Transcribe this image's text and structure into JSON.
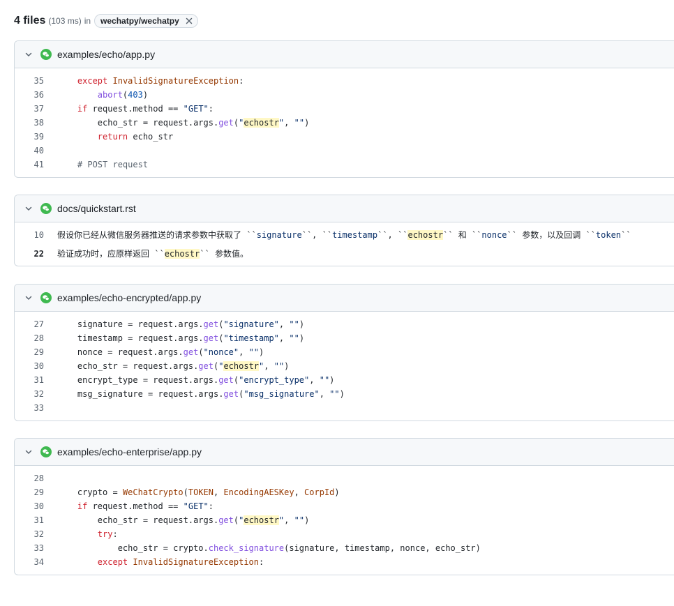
{
  "search": {
    "file_count": "4 files",
    "timing": "(103 ms)",
    "in_label": "in",
    "repo": "wechatpy/wechatpy"
  },
  "results": [
    {
      "path": "examples/echo/app.py",
      "lines": [
        {
          "n": "35",
          "tokens": [
            [
              "",
              "    "
            ],
            [
              "k",
              "except"
            ],
            [
              "",
              " "
            ],
            [
              "cn",
              "InvalidSignatureException"
            ],
            [
              "",
              ":"
            ]
          ]
        },
        {
          "n": "36",
          "tokens": [
            [
              "",
              "        "
            ],
            [
              "f",
              "abort"
            ],
            [
              "",
              "("
            ],
            [
              "n",
              "403"
            ],
            [
              "",
              ")"
            ]
          ]
        },
        {
          "n": "37",
          "tokens": [
            [
              "",
              "    "
            ],
            [
              "k",
              "if"
            ],
            [
              "",
              " request.method == "
            ],
            [
              "s",
              "\"GET\""
            ],
            [
              "",
              ":"
            ]
          ]
        },
        {
          "n": "38",
          "tokens": [
            [
              "",
              "        echo_str = request.args."
            ],
            [
              "f",
              "get"
            ],
            [
              "",
              "("
            ],
            [
              "s",
              "\""
            ],
            [
              "hl",
              "echostr"
            ],
            [
              "s",
              "\""
            ],
            [
              "",
              ", "
            ],
            [
              "s",
              "\"\""
            ],
            [
              "",
              ")"
            ]
          ]
        },
        {
          "n": "39",
          "tokens": [
            [
              "",
              "        "
            ],
            [
              "k",
              "return"
            ],
            [
              "",
              " echo_str"
            ]
          ]
        },
        {
          "n": "40",
          "tokens": []
        },
        {
          "n": "41",
          "tokens": [
            [
              "",
              "    "
            ],
            [
              "c",
              "# POST request"
            ]
          ]
        }
      ]
    },
    {
      "path": "docs/quickstart.rst",
      "lines": [
        {
          "n": "10",
          "hit": false,
          "tokens": [
            [
              "",
              "假设你已经从微信服务器推送的请求参数中获取了 ``"
            ],
            [
              "s",
              "signature"
            ],
            [
              "",
              "``, ``"
            ],
            [
              "s",
              "timestamp"
            ],
            [
              "",
              "``, ``"
            ],
            [
              "hl",
              "echostr"
            ],
            [
              "",
              "`` 和 ``"
            ],
            [
              "s",
              "nonce"
            ],
            [
              "",
              "`` 参数，以及回调 ``"
            ],
            [
              "s",
              "token"
            ],
            [
              "",
              "``"
            ]
          ]
        },
        {
          "n": "22",
          "hit": true,
          "tokens": [
            [
              "",
              "验证成功时，应原样返回 ``"
            ],
            [
              "hl",
              "echostr"
            ],
            [
              "",
              "`` 参数值。"
            ]
          ]
        }
      ]
    },
    {
      "path": "examples/echo-encrypted/app.py",
      "lines": [
        {
          "n": "27",
          "tokens": [
            [
              "",
              "    signature = request.args."
            ],
            [
              "f",
              "get"
            ],
            [
              "",
              "("
            ],
            [
              "s",
              "\"signature\""
            ],
            [
              "",
              ", "
            ],
            [
              "s",
              "\"\""
            ],
            [
              "",
              ")"
            ]
          ]
        },
        {
          "n": "28",
          "tokens": [
            [
              "",
              "    timestamp = request.args."
            ],
            [
              "f",
              "get"
            ],
            [
              "",
              "("
            ],
            [
              "s",
              "\"timestamp\""
            ],
            [
              "",
              ", "
            ],
            [
              "s",
              "\"\""
            ],
            [
              "",
              ")"
            ]
          ]
        },
        {
          "n": "29",
          "tokens": [
            [
              "",
              "    nonce = request.args."
            ],
            [
              "f",
              "get"
            ],
            [
              "",
              "("
            ],
            [
              "s",
              "\"nonce\""
            ],
            [
              "",
              ", "
            ],
            [
              "s",
              "\"\""
            ],
            [
              "",
              ")"
            ]
          ]
        },
        {
          "n": "30",
          "tokens": [
            [
              "",
              "    echo_str = request.args."
            ],
            [
              "f",
              "get"
            ],
            [
              "",
              "("
            ],
            [
              "s",
              "\""
            ],
            [
              "hl",
              "echostr"
            ],
            [
              "s",
              "\""
            ],
            [
              "",
              ", "
            ],
            [
              "s",
              "\"\""
            ],
            [
              "",
              ")"
            ]
          ]
        },
        {
          "n": "31",
          "tokens": [
            [
              "",
              "    encrypt_type = request.args."
            ],
            [
              "f",
              "get"
            ],
            [
              "",
              "("
            ],
            [
              "s",
              "\"encrypt_type\""
            ],
            [
              "",
              ", "
            ],
            [
              "s",
              "\"\""
            ],
            [
              "",
              ")"
            ]
          ]
        },
        {
          "n": "32",
          "tokens": [
            [
              "",
              "    msg_signature = request.args."
            ],
            [
              "f",
              "get"
            ],
            [
              "",
              "("
            ],
            [
              "s",
              "\"msg_signature\""
            ],
            [
              "",
              ", "
            ],
            [
              "s",
              "\"\""
            ],
            [
              "",
              ")"
            ]
          ]
        },
        {
          "n": "33",
          "tokens": []
        }
      ]
    },
    {
      "path": "examples/echo-enterprise/app.py",
      "lines": [
        {
          "n": "28",
          "tokens": []
        },
        {
          "n": "29",
          "tokens": [
            [
              "",
              "    crypto = "
            ],
            [
              "cn",
              "WeChatCrypto"
            ],
            [
              "",
              "("
            ],
            [
              "cn",
              "TOKEN"
            ],
            [
              "",
              ", "
            ],
            [
              "cn",
              "EncodingAESKey"
            ],
            [
              "",
              ", "
            ],
            [
              "cn",
              "CorpId"
            ],
            [
              "",
              ")"
            ]
          ]
        },
        {
          "n": "30",
          "tokens": [
            [
              "",
              "    "
            ],
            [
              "k",
              "if"
            ],
            [
              "",
              " request.method == "
            ],
            [
              "s",
              "\"GET\""
            ],
            [
              "",
              ":"
            ]
          ]
        },
        {
          "n": "31",
          "tokens": [
            [
              "",
              "        echo_str = request.args."
            ],
            [
              "f",
              "get"
            ],
            [
              "",
              "("
            ],
            [
              "s",
              "\""
            ],
            [
              "hl",
              "echostr"
            ],
            [
              "s",
              "\""
            ],
            [
              "",
              ", "
            ],
            [
              "s",
              "\"\""
            ],
            [
              "",
              ")"
            ]
          ]
        },
        {
          "n": "32",
          "tokens": [
            [
              "",
              "        "
            ],
            [
              "k",
              "try"
            ],
            [
              "",
              ":"
            ]
          ]
        },
        {
          "n": "33",
          "tokens": [
            [
              "",
              "            echo_str = crypto."
            ],
            [
              "f",
              "check_signature"
            ],
            [
              "",
              "(signature, timestamp, nonce, echo_str)"
            ]
          ]
        },
        {
          "n": "34",
          "tokens": [
            [
              "",
              "        "
            ],
            [
              "k",
              "except"
            ],
            [
              "",
              " "
            ],
            [
              "cn",
              "InvalidSignatureException"
            ],
            [
              "",
              ":"
            ]
          ]
        }
      ]
    }
  ],
  "icons": {
    "remove_filter": "close-icon",
    "collapse": "chevron-down-icon",
    "repo_avatar": "wechat-icon"
  },
  "colors": {
    "keyword": "#cf222e",
    "function": "#8250df",
    "string": "#0a3069",
    "constant": "#953800",
    "highlight": "#fff8c5",
    "wechat_green": "#3fb950"
  }
}
